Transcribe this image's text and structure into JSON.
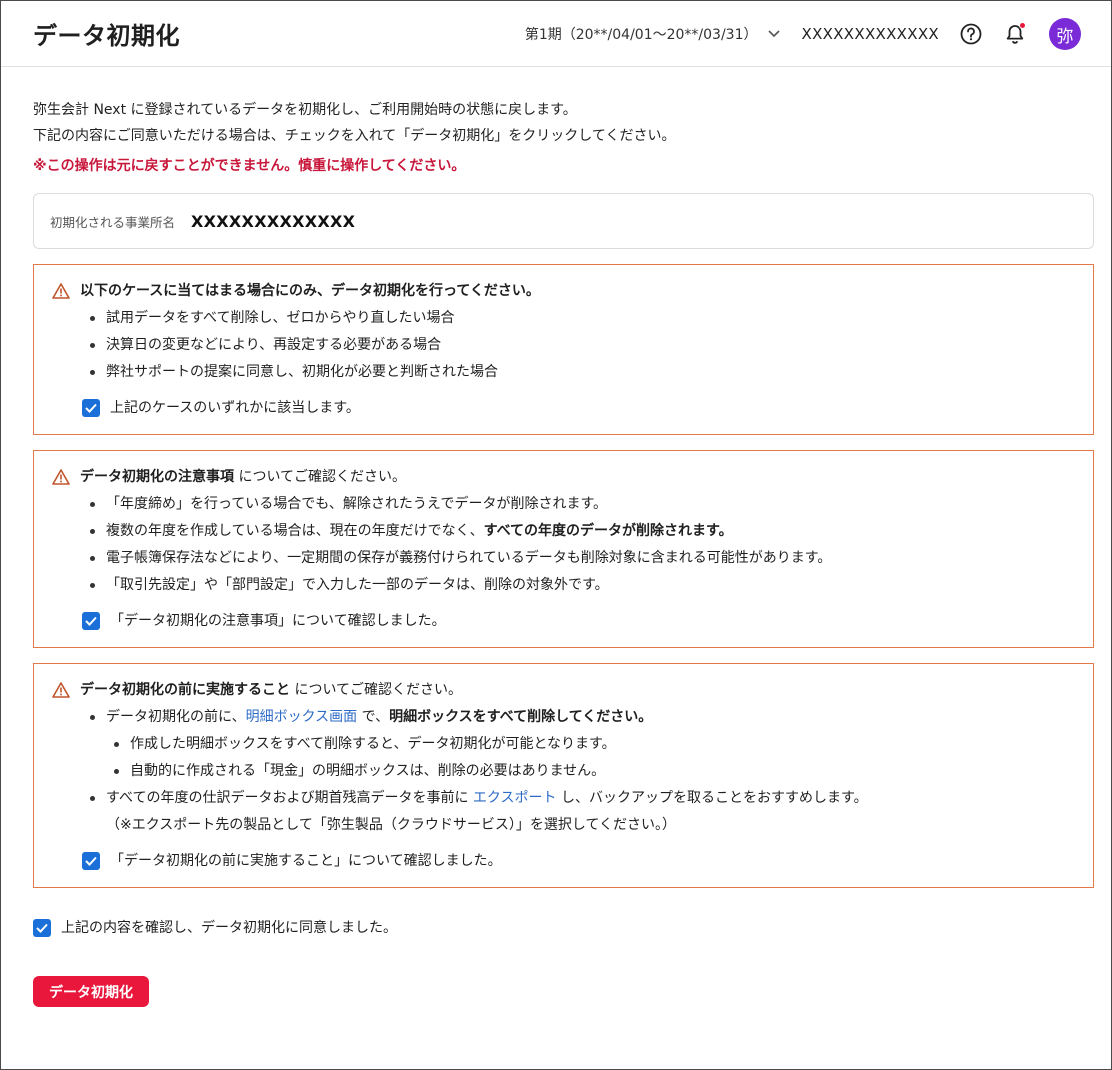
{
  "header": {
    "title": "データ初期化",
    "period": "第1期（20**/04/01〜20**/03/31）",
    "office": "XXXXXXXXXXXXX",
    "avatar_initial": "弥"
  },
  "intro": {
    "line1": "弥生会計 Next に登録されているデータを初期化し、ご利用開始時の状態に戻します。",
    "line2": "下記の内容にご同意いただける場合は、チェックを入れて「データ初期化」をクリックしてください。",
    "warning": "※この操作は元に戻すことができません。慎重に操作してください。"
  },
  "office_box": {
    "label": "初期化される事業所名",
    "value": "XXXXXXXXXXXXX"
  },
  "notice1": {
    "title": "以下のケースに当てはまる場合にのみ、データ初期化を行ってください。",
    "items": [
      "試用データをすべて削除し、ゼロからやり直したい場合",
      "決算日の変更などにより、再設定する必要がある場合",
      "弊社サポートの提案に同意し、初期化が必要と判断された場合"
    ],
    "check_label": "上記のケースのいずれかに該当します。",
    "checked": true
  },
  "notice2": {
    "title_bold": "データ初期化の注意事項",
    "title_rest": " についてご確認ください。",
    "item1": "「年度締め」を行っている場合でも、解除されたうえでデータが削除されます。",
    "item2_pre": "複数の年度を作成している場合は、現在の年度だけでなく、",
    "item2_bold": "すべての年度のデータが削除されます。",
    "item3": "電子帳簿保存法などにより、一定期間の保存が義務付けられているデータも削除対象に含まれる可能性があります。",
    "item4": "「取引先設定」や「部門設定」で入力した一部のデータは、削除の対象外です。",
    "check_label": "「データ初期化の注意事項」について確認しました。",
    "checked": true
  },
  "notice3": {
    "title_bold": "データ初期化の前に実施すること",
    "title_rest": " についてご確認ください。",
    "item1_pre": "データ初期化の前に、",
    "item1_link": "明細ボックス画面",
    "item1_mid": " で、",
    "item1_bold": "明細ボックスをすべて削除してください。",
    "sub1": "作成した明細ボックスをすべて削除すると、データ初期化が可能となります。",
    "sub2": "自動的に作成される「現金」の明細ボックスは、削除の必要はありません。",
    "item2_pre": "すべての年度の仕訳データおよび期首残高データを事前に ",
    "item2_link": "エクスポート",
    "item2_post": " し、バックアップを取ることをおすすめします。",
    "item2_note": "（※エクスポート先の製品として「弥生製品（クラウドサービス）」を選択してください。）",
    "check_label": "「データ初期化の前に実施すること」について確認しました。",
    "checked": true
  },
  "final": {
    "check_label": "上記の内容を確認し、データ初期化に同意しました。",
    "checked": true,
    "button_label": "データ初期化"
  },
  "colors": {
    "accent": "#e8173b",
    "checkbox": "#1a6fd8",
    "notice_border": "#e07a4a",
    "link": "#2e6bc6",
    "avatar": "#7a2ad6"
  }
}
